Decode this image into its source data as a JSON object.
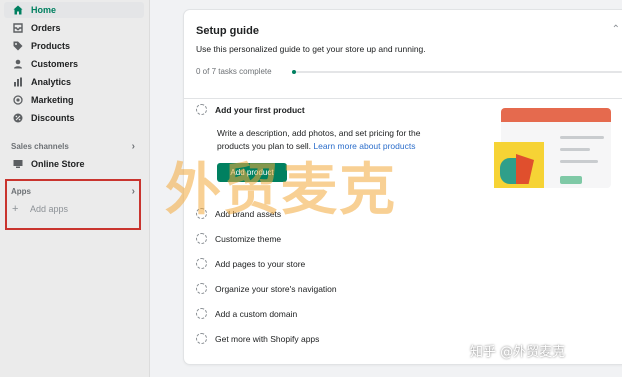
{
  "sidebar": {
    "items": [
      {
        "label": "Home",
        "icon": "home-icon"
      },
      {
        "label": "Orders",
        "icon": "orders-icon"
      },
      {
        "label": "Products",
        "icon": "tag-icon"
      },
      {
        "label": "Customers",
        "icon": "person-icon"
      },
      {
        "label": "Analytics",
        "icon": "bar-chart-icon"
      },
      {
        "label": "Marketing",
        "icon": "target-icon"
      },
      {
        "label": "Discounts",
        "icon": "discount-icon"
      }
    ],
    "sales_channels": {
      "heading": "Sales channels",
      "online_store": "Online Store"
    },
    "apps": {
      "heading": "Apps",
      "add_apps": "Add apps"
    }
  },
  "setup_guide": {
    "title": "Setup guide",
    "subtitle": "Use this personalized guide to get your store up and running.",
    "progress_text": "0 of 7 tasks complete",
    "progress": 0.0,
    "first_task": {
      "title": "Add your first product",
      "description": "Write a description, add photos, and set pricing for the products you plan to sell.",
      "link": "Learn more about products",
      "button": "Add product"
    },
    "tasks": [
      "Add brand assets",
      "Customize theme",
      "Add pages to your store",
      "Organize your store's navigation",
      "Add a custom domain",
      "Get more with Shopify apps"
    ]
  },
  "watermark": {
    "big": "外贸麦克",
    "small": "知乎 @外贸麦克"
  },
  "colors": {
    "accent": "#008060",
    "link": "#2c6ecb",
    "highlight_box": "#c9342e"
  }
}
